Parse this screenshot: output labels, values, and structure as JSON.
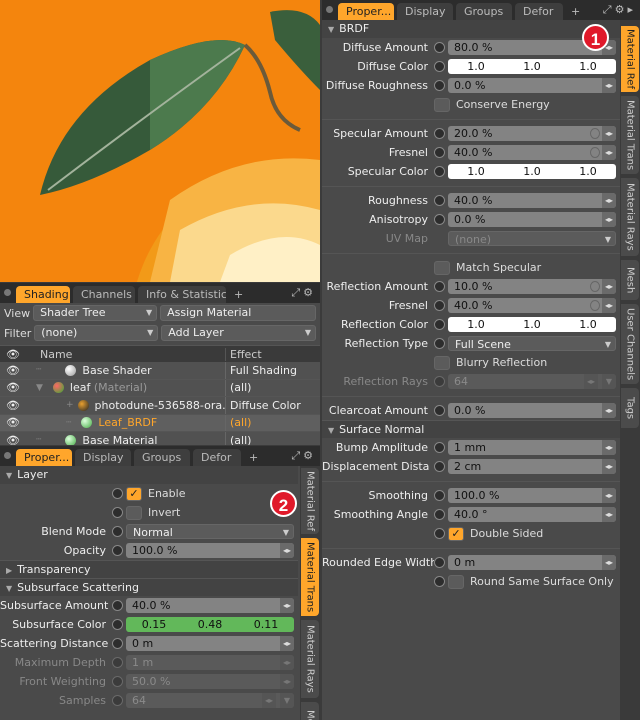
{
  "viewport": {
    "background": "#f0820e"
  },
  "accent": "#ffa62b",
  "right_panel": {
    "tabs": [
      "Proper...",
      "Display",
      "Groups",
      "Defor"
    ],
    "plus": "+",
    "badge": "1",
    "vtabs": [
      "Material Ref",
      "Material Trans",
      "Material Rays",
      "Mesh",
      "User Channels",
      "Tags"
    ],
    "brdf_title": "BRDF",
    "diffuse_amount": {
      "label": "Diffuse Amount",
      "value": "80.0 %"
    },
    "diffuse_color": {
      "label": "Diffuse Color",
      "r": "1.0",
      "g": "1.0",
      "b": "1.0"
    },
    "diffuse_roughness": {
      "label": "Diffuse Roughness",
      "value": "0.0 %"
    },
    "conserve_energy": "Conserve Energy",
    "specular_amount": {
      "label": "Specular Amount",
      "value": "20.0 %"
    },
    "fresnel1": {
      "label": "Fresnel",
      "value": "40.0 %"
    },
    "specular_color": {
      "label": "Specular Color",
      "r": "1.0",
      "g": "1.0",
      "b": "1.0"
    },
    "roughness": {
      "label": "Roughness",
      "value": "40.0 %"
    },
    "anisotropy": {
      "label": "Anisotropy",
      "value": "0.0 %"
    },
    "uv_map": {
      "label": "UV Map",
      "value": "(none)"
    },
    "match_specular": "Match Specular",
    "reflection_amount": {
      "label": "Reflection Amount",
      "value": "10.0 %"
    },
    "fresnel2": {
      "label": "Fresnel",
      "value": "40.0 %"
    },
    "reflection_color": {
      "label": "Reflection Color",
      "r": "1.0",
      "g": "1.0",
      "b": "1.0"
    },
    "reflection_type": {
      "label": "Reflection Type",
      "value": "Full Scene"
    },
    "blurry_reflection": "Blurry Reflection",
    "reflection_rays": {
      "label": "Reflection Rays",
      "value": "64"
    },
    "clearcoat_amount": {
      "label": "Clearcoat Amount",
      "value": "0.0 %"
    },
    "surface_normal_title": "Surface Normal",
    "bump_amplitude": {
      "label": "Bump Amplitude",
      "value": "1 mm"
    },
    "displacement_distance": {
      "label": "Displacement Dista ...",
      "value": "2 cm"
    },
    "smoothing": {
      "label": "Smoothing",
      "value": "100.0 %"
    },
    "smoothing_angle": {
      "label": "Smoothing Angle",
      "value": "40.0 °"
    },
    "double_sided": "Double Sided",
    "rounded_edge_width": {
      "label": "Rounded Edge Width",
      "value": "0 m"
    },
    "round_same_surface": "Round Same Surface Only"
  },
  "shading_panel": {
    "tabs": [
      "Shading",
      "Channels",
      "Info & Statistics"
    ],
    "plus": "+",
    "view_label": "View",
    "view_value": "Shader Tree",
    "assign_material": "Assign Material",
    "filter_label": "Filter",
    "filter_value": "(none)",
    "add_layer": "Add Layer",
    "col_name": "Name",
    "col_effect": "Effect",
    "rows": [
      {
        "name": "Base Shader",
        "effect": "Full Shading"
      },
      {
        "name": "leaf",
        "name_suffix": "(Material)",
        "effect": "(all)"
      },
      {
        "name": "photodune-536588-ora...",
        "effect": "Diffuse Color"
      },
      {
        "name": "Leaf_BRDF",
        "effect": "(all)"
      },
      {
        "name": "Base Material",
        "effect": "(all)"
      }
    ]
  },
  "bottom_panel": {
    "tabs": [
      "Proper...",
      "Display",
      "Groups",
      "Defor"
    ],
    "plus": "+",
    "badge": "2",
    "vtabs": [
      "Material Ref",
      "Material Trans",
      "Material Rays",
      "Me"
    ],
    "layer_title": "Layer",
    "enable": "Enable",
    "invert": "Invert",
    "blend_mode": {
      "label": "Blend Mode",
      "value": "Normal"
    },
    "opacity": {
      "label": "Opacity",
      "value": "100.0 %"
    },
    "transparency_title": "Transparency",
    "sss_title": "Subsurface Scattering",
    "subsurface_amount": {
      "label": "Subsurface Amount",
      "value": "40.0 %"
    },
    "subsurface_color": {
      "label": "Subsurface Color",
      "r": "0.15",
      "g": "0.48",
      "b": "0.11"
    },
    "scattering_distance": {
      "label": "Scattering Distance",
      "value": "0 m"
    },
    "maximum_depth": {
      "label": "Maximum Depth",
      "value": "1 m"
    },
    "front_weighting": {
      "label": "Front Weighting",
      "value": "50.0 %"
    },
    "samples": {
      "label": "Samples",
      "value": "64"
    }
  }
}
